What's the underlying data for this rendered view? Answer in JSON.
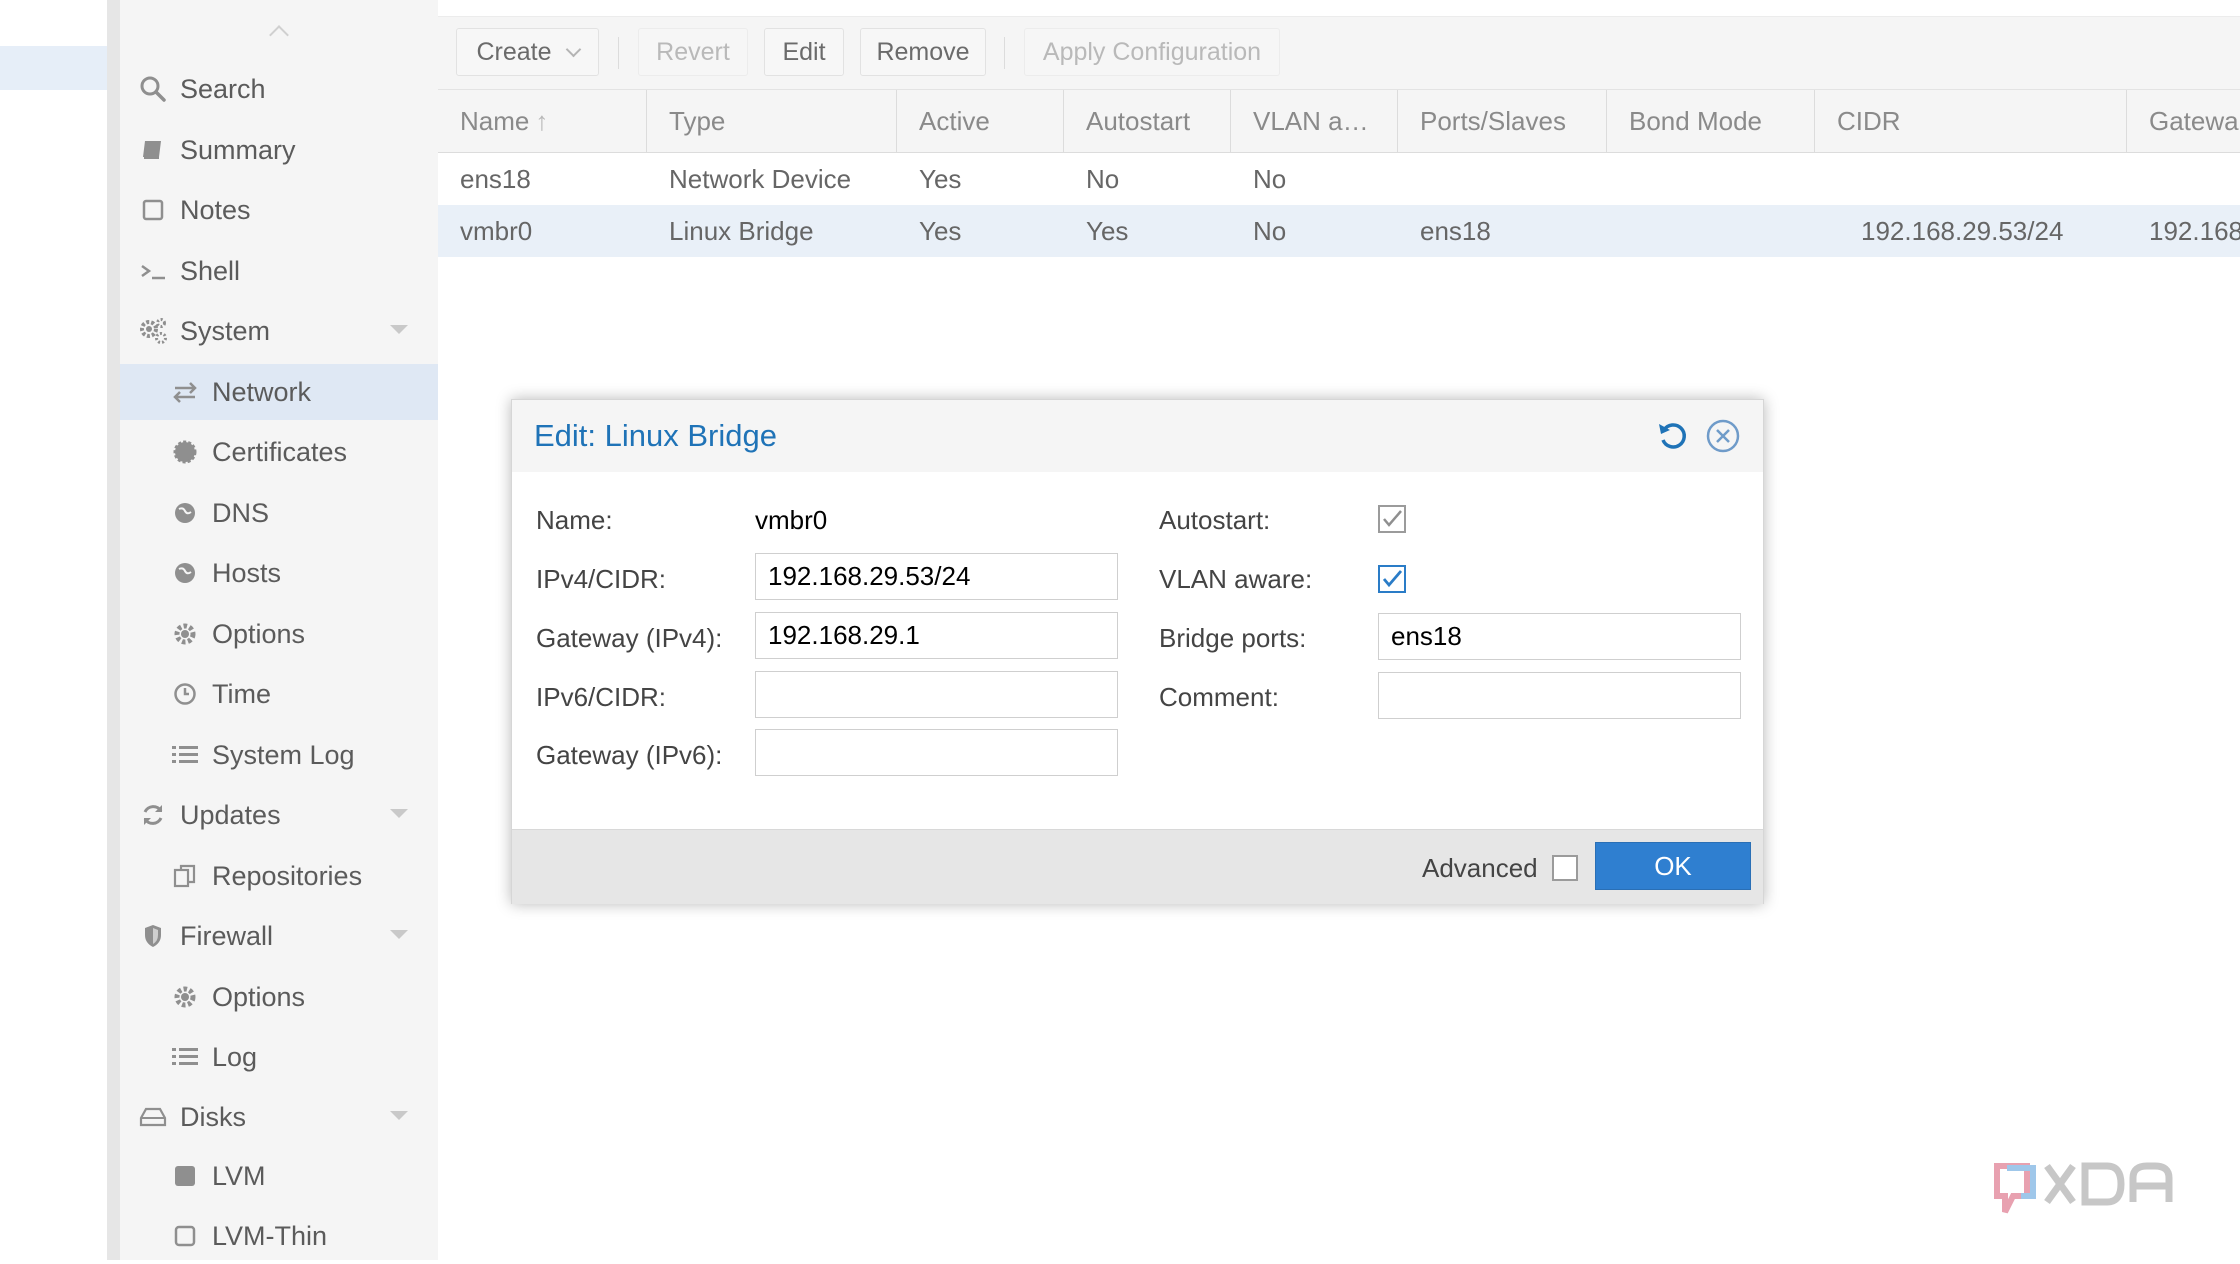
{
  "menu": {
    "items": [
      {
        "label": "Search",
        "icon": "search-icon",
        "level": 1
      },
      {
        "label": "Summary",
        "icon": "book-icon",
        "level": 1
      },
      {
        "label": "Notes",
        "icon": "note-icon",
        "level": 1
      },
      {
        "label": "Shell",
        "icon": "terminal-icon",
        "level": 1
      },
      {
        "label": "System",
        "icon": "gears-icon",
        "level": 1,
        "expandable": true
      },
      {
        "label": "Network",
        "icon": "exchange-icon",
        "level": 2,
        "selected": true
      },
      {
        "label": "Certificates",
        "icon": "certificate-icon",
        "level": 2
      },
      {
        "label": "DNS",
        "icon": "globe-icon",
        "level": 2
      },
      {
        "label": "Hosts",
        "icon": "globe-icon",
        "level": 2
      },
      {
        "label": "Options",
        "icon": "gear-icon",
        "level": 2
      },
      {
        "label": "Time",
        "icon": "clock-icon",
        "level": 2
      },
      {
        "label": "System Log",
        "icon": "list-icon",
        "level": 2
      },
      {
        "label": "Updates",
        "icon": "refresh-icon",
        "level": 1,
        "expandable": true
      },
      {
        "label": "Repositories",
        "icon": "files-icon",
        "level": 2
      },
      {
        "label": "Firewall",
        "icon": "shield-icon",
        "level": 1,
        "expandable": true
      },
      {
        "label": "Options",
        "icon": "gear-icon",
        "level": 2
      },
      {
        "label": "Log",
        "icon": "list-icon",
        "level": 2
      },
      {
        "label": "Disks",
        "icon": "hdd-icon",
        "level": 1,
        "expandable": true
      },
      {
        "label": "LVM",
        "icon": "square-icon",
        "level": 2
      },
      {
        "label": "LVM-Thin",
        "icon": "square-outline-icon",
        "level": 2
      }
    ]
  },
  "toolbar": {
    "create": "Create",
    "revert": "Revert",
    "edit": "Edit",
    "remove": "Remove",
    "apply": "Apply Configuration"
  },
  "table": {
    "columns": [
      "Name",
      "Type",
      "Active",
      "Autostart",
      "VLAN a…",
      "Ports/Slaves",
      "Bond Mode",
      "CIDR",
      "Gatewa"
    ],
    "rows": [
      [
        "ens18",
        "Network Device",
        "Yes",
        "No",
        "No",
        "",
        "",
        "",
        ""
      ],
      [
        "vmbr0",
        "Linux Bridge",
        "Yes",
        "Yes",
        "No",
        "ens18",
        "",
        "192.168.29.53/24",
        "192.168"
      ]
    ]
  },
  "dialog": {
    "title": "Edit: Linux Bridge",
    "name_label": "Name:",
    "name_value": "vmbr0",
    "ipv4_label": "IPv4/CIDR:",
    "ipv4_value": "192.168.29.53/24",
    "gw4_label": "Gateway (IPv4):",
    "gw4_value": "192.168.29.1",
    "ipv6_label": "IPv6/CIDR:",
    "ipv6_value": "",
    "gw6_label": "Gateway (IPv6):",
    "gw6_value": "",
    "autostart_label": "Autostart:",
    "autostart_checked": true,
    "vlan_label": "VLAN aware:",
    "vlan_checked": true,
    "bridge_ports_label": "Bridge ports:",
    "bridge_ports_value": "ens18",
    "comment_label": "Comment:",
    "comment_value": "",
    "advanced_label": "Advanced",
    "advanced_checked": false,
    "ok_label": "OK"
  },
  "colors": {
    "accent": "#2f7fd0",
    "title_blue": "#1f73b7",
    "selection": "#dfe8f4"
  }
}
